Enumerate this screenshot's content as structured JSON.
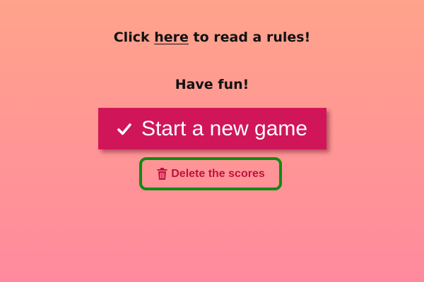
{
  "rules": {
    "prefix": "Click ",
    "link_text": "here",
    "suffix": " to read a rules!"
  },
  "fun_text": "Have fun!",
  "start_button": {
    "label": "Start a new game",
    "icon": "check-icon"
  },
  "delete_button": {
    "label": "Delete the scores",
    "icon": "trash-icon"
  },
  "colors": {
    "background_top": "#FFA38B",
    "background_bottom": "#FF8A9E",
    "primary_button": "#D01658",
    "delete_text": "#C0103E",
    "focus_outline": "#118A11"
  }
}
